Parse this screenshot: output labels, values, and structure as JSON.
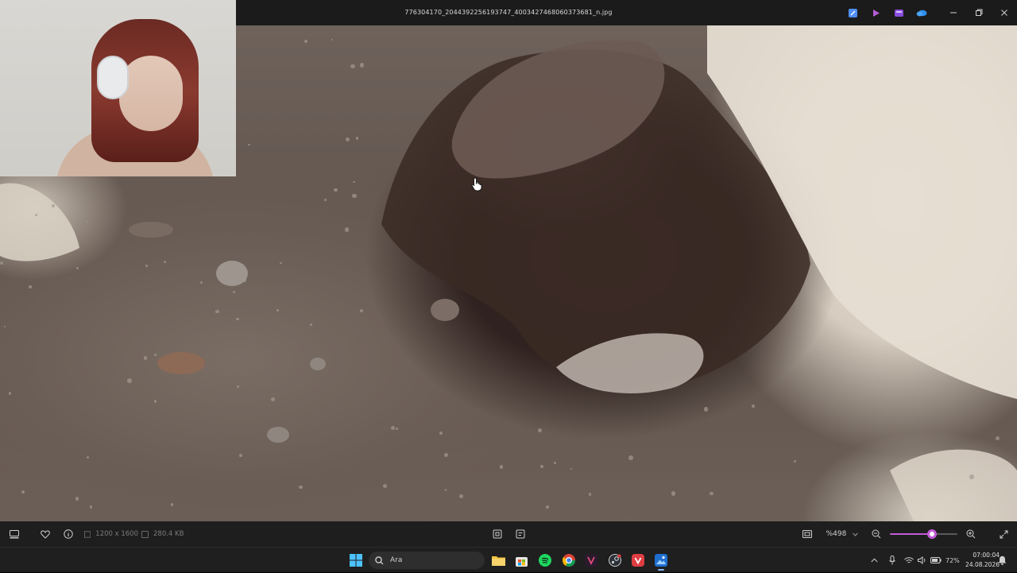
{
  "titlebar": {
    "filename": "776304170_2044392256193747_4003427468060373681_n.jpg",
    "icons": [
      "edit-icon",
      "clipchamp-icon",
      "designer-icon",
      "onedrive-icon"
    ],
    "window_controls": [
      "minimize",
      "restore",
      "close"
    ]
  },
  "viewer": {
    "webcam_overlay": true
  },
  "toolbar": {
    "dimensions": "1200 x 1600",
    "file_size": "280.4 KB",
    "zoom_label": "%498",
    "zoom_level": 0.62
  },
  "taskbar": {
    "search_placeholder": "Ara",
    "battery": "72%",
    "time": "07:00:04",
    "date": "24.08.2026"
  },
  "colors": {
    "accent": "#c25bd6",
    "titlebar_bg": "#1b1b1b",
    "toolbar_bg": "#1e1e1e",
    "taskbar_bg": "#1f1f1f"
  }
}
